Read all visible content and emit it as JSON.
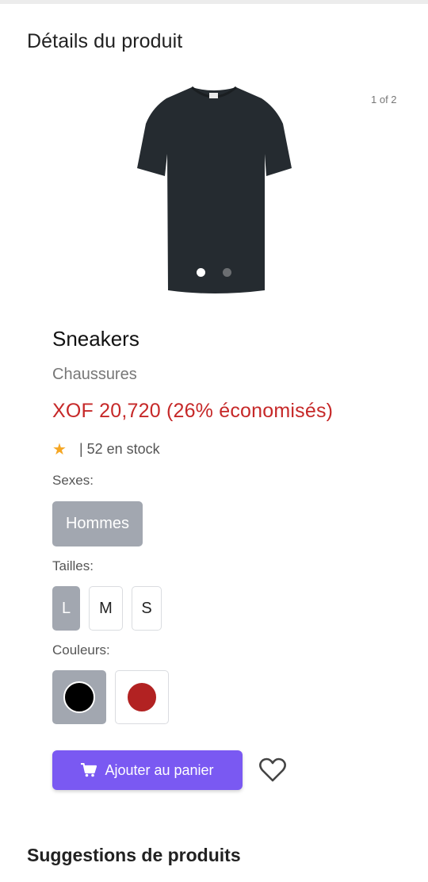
{
  "page": {
    "title": "Détails du produit"
  },
  "carousel": {
    "counter": "1 of 2",
    "image_icon": "tshirt-image",
    "current": 1,
    "total": 2
  },
  "product": {
    "name": "Sneakers",
    "category": "Chaussures",
    "price": "XOF 20,720 (26% économisés)",
    "rating_icon": "star-icon",
    "stock": "| 52 en stock"
  },
  "options": {
    "sexes_label": "Sexes:",
    "sexes": [
      {
        "label": "Hommes",
        "selected": true
      }
    ],
    "sizes_label": "Tailles:",
    "sizes": [
      {
        "label": "L",
        "selected": true
      },
      {
        "label": "M",
        "selected": false
      },
      {
        "label": "S",
        "selected": false
      }
    ],
    "colors_label": "Couleurs:",
    "colors": [
      {
        "name": "black",
        "hex": "#000000",
        "selected": true
      },
      {
        "name": "red",
        "hex": "#b22222",
        "selected": false
      }
    ]
  },
  "actions": {
    "add_to_cart": "Ajouter au panier",
    "cart_icon": "cart-icon",
    "wishlist_icon": "heart-icon"
  },
  "suggestions": {
    "title": "Suggestions de produits"
  },
  "colors": {
    "accent": "#7a59f2",
    "price": "#c62828",
    "selected_bg": "#a2a7b0",
    "star": "#f5a623"
  }
}
